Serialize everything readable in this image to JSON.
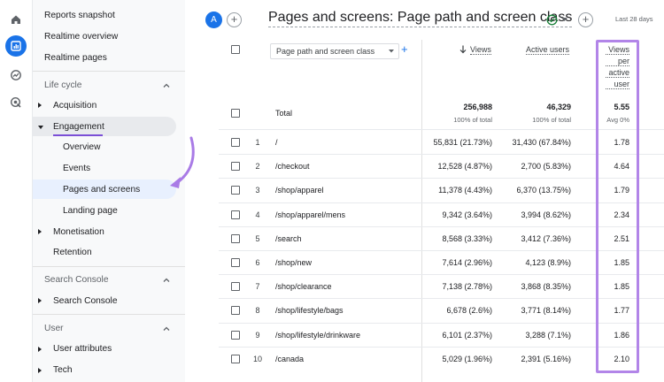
{
  "rail": {
    "icons": [
      "home-icon",
      "reports-icon",
      "explore-icon",
      "advertising-icon"
    ]
  },
  "nav": {
    "reports_snapshot": "Reports snapshot",
    "realtime_overview": "Realtime overview",
    "realtime_pages": "Realtime pages",
    "life_cycle": "Life cycle",
    "acquisition": "Acquisition",
    "engagement": "Engagement",
    "overview": "Overview",
    "events": "Events",
    "pages_and_screens": "Pages and screens",
    "landing_page": "Landing page",
    "monetisation": "Monetisation",
    "retention": "Retention",
    "search_console_section": "Search Console",
    "search_console_item": "Search Console",
    "user_section": "User",
    "user_attributes": "User attributes",
    "tech": "Tech"
  },
  "header": {
    "avatar_letter": "A",
    "title": "Pages and screens: Page path and screen class",
    "date_range": "Last 28 days",
    "accent": "#1a73e8"
  },
  "table": {
    "dimension_label": "Page path and screen class",
    "col_views": "Views",
    "col_active_users": "Active users",
    "col_vpu_line1": "Views",
    "col_vpu_line2": "per",
    "col_vpu_line3": "active",
    "col_vpu_line4": "user",
    "total_label": "Total",
    "total_views": "256,988",
    "total_views_sub": "100% of total",
    "total_users": "46,329",
    "total_users_sub": "100% of total",
    "total_vpu": "5.55",
    "total_vpu_sub": "Avg 0%",
    "highlight_color": "#b285e8",
    "rows": [
      {
        "n": "1",
        "path": "/",
        "views": "55,831 (21.73%)",
        "users": "31,430 (67.84%)",
        "vpu": "1.78"
      },
      {
        "n": "2",
        "path": "/checkout",
        "views": "12,528 (4.87%)",
        "users": "2,700 (5.83%)",
        "vpu": "4.64"
      },
      {
        "n": "3",
        "path": "/shop/apparel",
        "views": "11,378 (4.43%)",
        "users": "6,370 (13.75%)",
        "vpu": "1.79"
      },
      {
        "n": "4",
        "path": "/shop/apparel/mens",
        "views": "9,342 (3.64%)",
        "users": "3,994 (8.62%)",
        "vpu": "2.34"
      },
      {
        "n": "5",
        "path": "/search",
        "views": "8,568 (3.33%)",
        "users": "3,412 (7.36%)",
        "vpu": "2.51"
      },
      {
        "n": "6",
        "path": "/shop/new",
        "views": "7,614 (2.96%)",
        "users": "4,123 (8.9%)",
        "vpu": "1.85"
      },
      {
        "n": "7",
        "path": "/shop/clearance",
        "views": "7,138 (2.78%)",
        "users": "3,868 (8.35%)",
        "vpu": "1.85"
      },
      {
        "n": "8",
        "path": "/shop/lifestyle/bags",
        "views": "6,678 (2.6%)",
        "users": "3,771 (8.14%)",
        "vpu": "1.77"
      },
      {
        "n": "9",
        "path": "/shop/lifestyle/drinkware",
        "views": "6,101 (2.37%)",
        "users": "3,288 (7.1%)",
        "vpu": "1.86"
      },
      {
        "n": "10",
        "path": "/canada",
        "views": "5,029 (1.96%)",
        "users": "2,391 (5.16%)",
        "vpu": "2.10"
      }
    ]
  }
}
